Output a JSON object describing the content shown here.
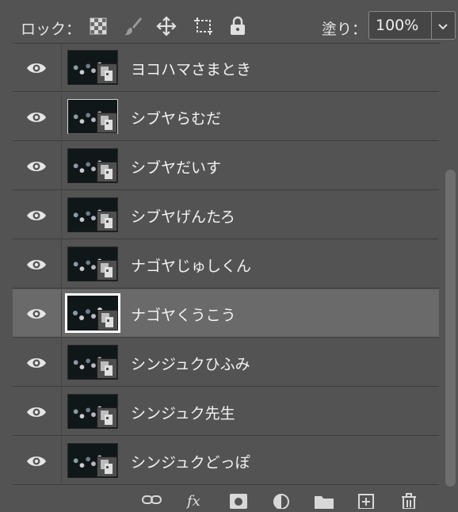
{
  "toolbar": {
    "lock_label": "ロック：",
    "fill_label": "塗り：",
    "fill_value": "100%",
    "icons": [
      "lock-transparent-pixels-icon",
      "lock-image-pixels-icon",
      "lock-position-icon",
      "lock-artboard-icon",
      "lock-all-icon",
      "chevron-down-icon"
    ]
  },
  "layers": [
    {
      "name": "ヨコハマさまとき",
      "selected": false
    },
    {
      "name": "シブヤらむだ",
      "selected": false
    },
    {
      "name": "シブヤだいす",
      "selected": false
    },
    {
      "name": "シブヤげんたろ",
      "selected": false
    },
    {
      "name": "ナゴヤじゅしくん",
      "selected": false
    },
    {
      "name": "ナゴヤくうこう",
      "selected": true
    },
    {
      "name": "シンジュクひふみ",
      "selected": false
    },
    {
      "name": "シンジュク先生",
      "selected": false
    },
    {
      "name": "シンジュクどっぽ",
      "selected": false
    }
  ],
  "bottom_bar": {
    "fx_label": "fx",
    "icons": [
      "link-layers-icon",
      "layer-style-icon",
      "add-mask-icon",
      "adjustment-layer-icon",
      "new-group-icon",
      "new-layer-icon",
      "delete-layer-icon"
    ]
  },
  "colors": {
    "panel_bg": "#535353",
    "selected_row_bg": "#6a6a6a",
    "text": "#f2f2f2"
  }
}
